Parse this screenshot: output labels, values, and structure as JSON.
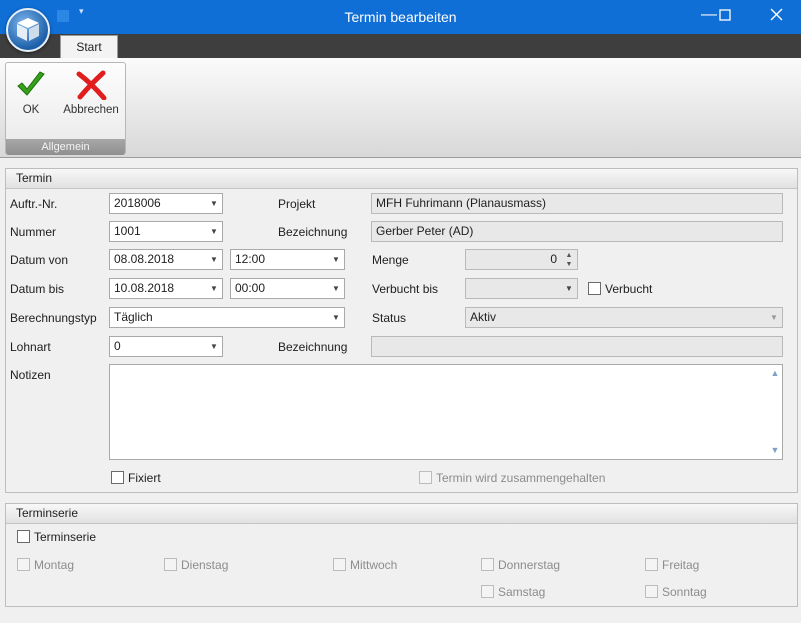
{
  "window": {
    "title": "Termin bearbeiten",
    "min_icon": "minimize-icon",
    "max_icon": "maximize-icon",
    "close_icon": "close-icon"
  },
  "ribbon": {
    "tab": "Start",
    "ok": "OK",
    "cancel": "Abbrechen",
    "group": "Allgemein"
  },
  "termin": {
    "header": "Termin",
    "auftr_label": "Auftr.-Nr.",
    "auftr_value": "2018006",
    "projekt_label": "Projekt",
    "projekt_value": "MFH Fuhrimann (Planausmass)",
    "nummer_label": "Nummer",
    "nummer_value": "1001",
    "bez1_label": "Bezeichnung",
    "bez1_value": "Gerber Peter (AD)",
    "dvon_label": "Datum von",
    "dvon_date": "08.08.2018",
    "dvon_time": "12:00",
    "menge_label": "Menge",
    "menge_value": "0",
    "dbis_label": "Datum bis",
    "dbis_date": "10.08.2018",
    "dbis_time": "00:00",
    "verbucht_bis_label": "Verbucht bis",
    "verbucht_bis_value": "",
    "verbucht_label": "Verbucht",
    "berech_label": "Berechnungstyp",
    "berech_value": "Täglich",
    "status_label": "Status",
    "status_value": "Aktiv",
    "lohnart_label": "Lohnart",
    "lohnart_value": "0",
    "bez2_label": "Bezeichnung",
    "bez2_value": "",
    "notizen_label": "Notizen",
    "notizen_value": "",
    "fixiert_label": "Fixiert",
    "zusammen_label": "Termin wird zusammengehalten"
  },
  "serie": {
    "header": "Terminserie",
    "terminserie": "Terminserie",
    "montag": "Montag",
    "dienstag": "Dienstag",
    "mittwoch": "Mittwoch",
    "donnerstag": "Donnerstag",
    "freitag": "Freitag",
    "samstag": "Samstag",
    "sonntag": "Sonntag"
  },
  "colors": {
    "titlebar": "#0f6fd6",
    "ok": "#2f9e18",
    "cancel": "#d61e1e"
  }
}
